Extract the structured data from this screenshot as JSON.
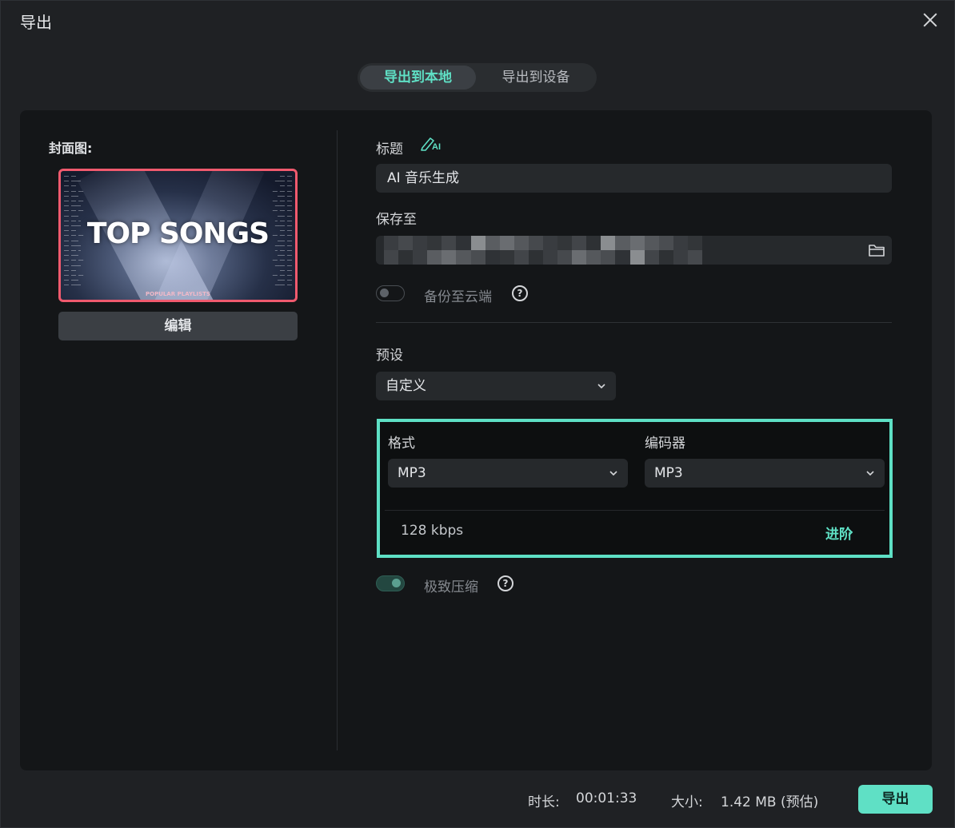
{
  "window": {
    "title": "导出"
  },
  "tabs": {
    "local": "导出到本地",
    "device": "导出到设备"
  },
  "cover": {
    "label": "封面图:",
    "headline": "TOP SONGS",
    "subline": "POPULAR PLAYLISTS",
    "edit_label": "编辑"
  },
  "form": {
    "title_label": "标题",
    "ai_badge": "AI",
    "title_value": "AI 音乐生成",
    "save_label": "保存至",
    "backup_label": "备份至云端",
    "backup_on": false,
    "preset_label": "预设",
    "preset_value": "自定义",
    "format_label": "格式",
    "format_value": "MP3",
    "encoder_label": "编码器",
    "encoder_value": "MP3",
    "bitrate": "128 kbps",
    "advanced_label": "进阶",
    "compress_label": "极致压缩",
    "compress_on": true
  },
  "footer": {
    "duration_label": "时长:",
    "duration_value": "00:01:33",
    "size_label": "大小:",
    "size_value": "1.42 MB (预估)",
    "export_label": "导出"
  },
  "colors": {
    "accent": "#5fe0c5",
    "cover_border": "#f05a6e",
    "background": "#1f2124",
    "panel": "#141618"
  }
}
